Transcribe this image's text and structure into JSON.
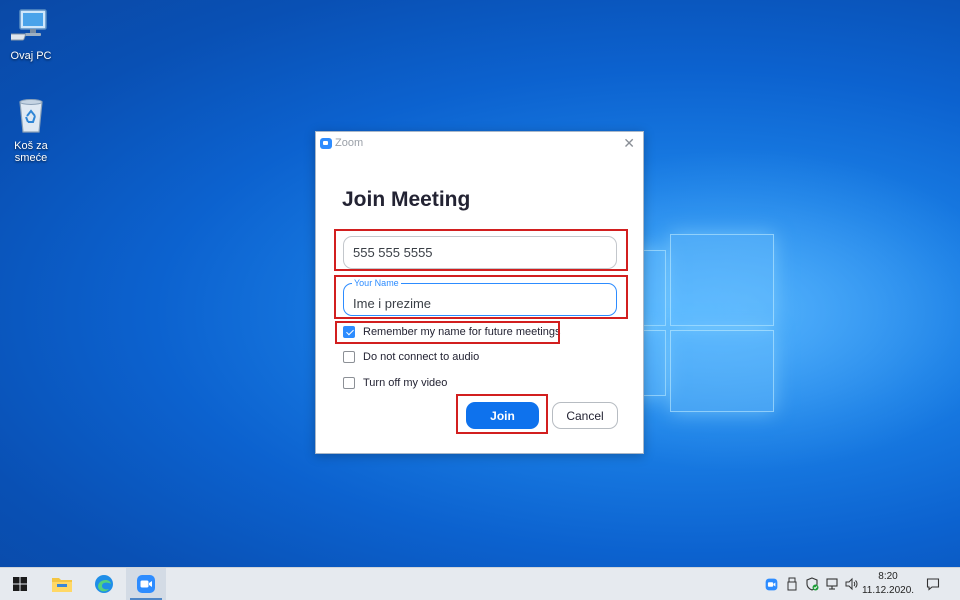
{
  "desktop": {
    "icons": [
      {
        "label": "Ovaj PC"
      },
      {
        "label": "Koš za smeće"
      }
    ]
  },
  "dialog": {
    "window_title": "Zoom",
    "heading": "Join Meeting",
    "meeting_id_value": "555 555 5555",
    "name_label": "Your Name",
    "name_value": "Ime i prezime",
    "options": [
      {
        "label": "Remember my name for future meetings",
        "checked": true
      },
      {
        "label": "Do not connect to audio",
        "checked": false
      },
      {
        "label": "Turn off my video",
        "checked": false
      }
    ],
    "join_label": "Join",
    "cancel_label": "Cancel"
  },
  "taskbar": {
    "time": "8:20",
    "date": "11.12.2020."
  },
  "colors": {
    "accent": "#0e72ed",
    "highlight": "#d21f1f"
  }
}
